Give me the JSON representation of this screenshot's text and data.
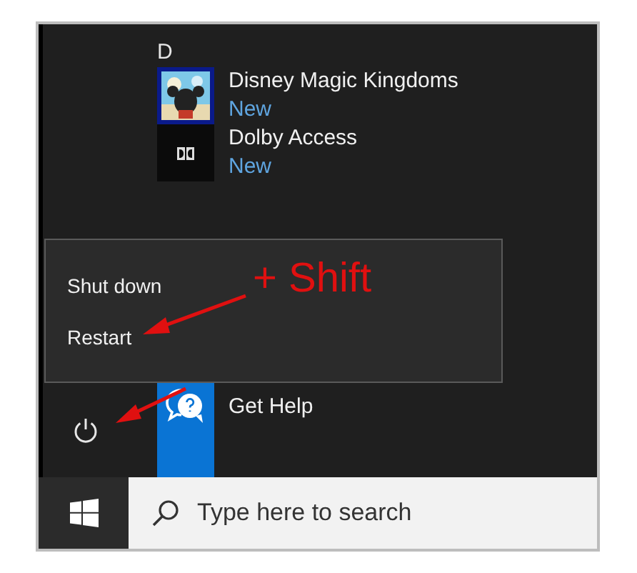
{
  "start_menu": {
    "section_header": "D",
    "apps": [
      {
        "name": "Disney Magic Kingdoms",
        "badge": "New",
        "kind": "picture"
      },
      {
        "name": "Dolby Access",
        "badge": "New",
        "kind": "dolby"
      }
    ],
    "tiles": [
      {
        "name": "Get Help",
        "kind": "help"
      }
    ]
  },
  "power_menu": {
    "items": [
      {
        "label": "Shut down"
      },
      {
        "label": "Restart"
      }
    ]
  },
  "annotation": {
    "text": "+ Shift"
  },
  "taskbar": {
    "search": {
      "placeholder": "Type here to search"
    }
  }
}
